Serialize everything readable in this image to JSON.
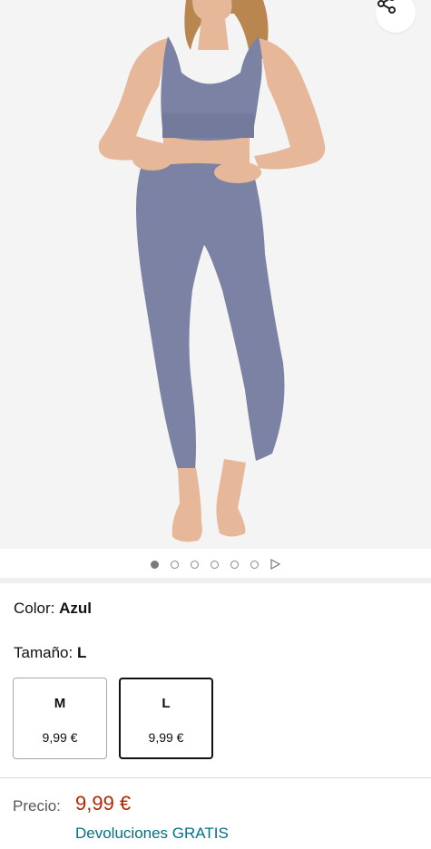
{
  "product": {
    "image_alt": "Mujer con conjunto deportivo azul grisáceo: top y leggings",
    "image_count": 6,
    "active_image_index": 0
  },
  "icons": {
    "share": "share-icon",
    "play": "play-icon"
  },
  "color": {
    "label": "Color: ",
    "value": "Azul"
  },
  "size": {
    "label": "Tamaño: ",
    "value": "L",
    "options": [
      {
        "size": "M",
        "price": "9,99 €",
        "selected": false
      },
      {
        "size": "L",
        "price": "9,99 €",
        "selected": true
      }
    ]
  },
  "price": {
    "label": "Precio:",
    "value": "9,99 €",
    "returns": "Devoluciones GRATIS"
  },
  "colors": {
    "price": "#b12704",
    "link": "#007185",
    "image_bg": "#f4f4f4",
    "garment": "#7c82a4"
  }
}
